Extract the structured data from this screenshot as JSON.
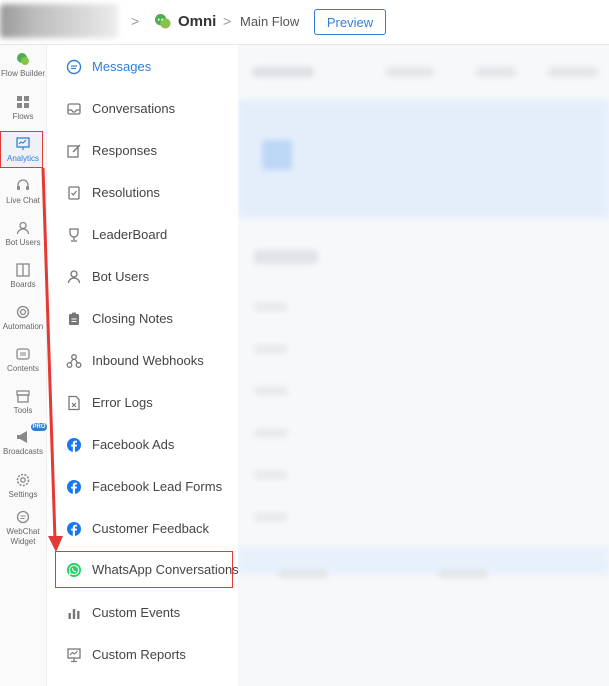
{
  "header": {
    "bot_name": "Omni",
    "flow_name": "Main Flow",
    "preview_label": "Preview",
    "separator": ">"
  },
  "rail": {
    "items": [
      {
        "label": "Flow Builder",
        "icon": "flow-builder-icon"
      },
      {
        "label": "Flows",
        "icon": "grid-icon"
      },
      {
        "label": "Analytics",
        "icon": "analytics-icon"
      },
      {
        "label": "Live Chat",
        "icon": "headset-icon"
      },
      {
        "label": "Bot Users",
        "icon": "user-icon"
      },
      {
        "label": "Boards",
        "icon": "board-icon"
      },
      {
        "label": "Automation",
        "icon": "automation-icon"
      },
      {
        "label": "Contents",
        "icon": "contents-icon"
      },
      {
        "label": "Tools",
        "icon": "tools-icon"
      },
      {
        "label": "Broadcasts",
        "icon": "megaphone-icon"
      },
      {
        "label": "Settings",
        "icon": "gear-icon"
      },
      {
        "label": "WebChat Widget",
        "icon": "chat-icon"
      }
    ],
    "pro_badge": "PRO"
  },
  "menu": {
    "items": [
      {
        "label": "Messages",
        "icon": "message-icon"
      },
      {
        "label": "Conversations",
        "icon": "inbox-icon"
      },
      {
        "label": "Responses",
        "icon": "edit-icon"
      },
      {
        "label": "Resolutions",
        "icon": "resolution-icon"
      },
      {
        "label": "LeaderBoard",
        "icon": "trophy-icon"
      },
      {
        "label": "Bot Users",
        "icon": "user-icon"
      },
      {
        "label": "Closing Notes",
        "icon": "clipboard-icon"
      },
      {
        "label": "Inbound Webhooks",
        "icon": "webhook-icon"
      },
      {
        "label": "Error Logs",
        "icon": "error-log-icon"
      },
      {
        "label": "Facebook Ads",
        "icon": "facebook-icon"
      },
      {
        "label": "Facebook Lead Forms",
        "icon": "facebook-icon"
      },
      {
        "label": "Customer Feedback",
        "icon": "facebook-icon"
      },
      {
        "label": "WhatsApp Conversations",
        "icon": "whatsapp-icon"
      },
      {
        "label": "Custom Events",
        "icon": "bar-chart-icon"
      },
      {
        "label": "Custom Reports",
        "icon": "report-icon"
      }
    ]
  },
  "colors": {
    "accent": "#2f7fd8",
    "highlight": "#e53935",
    "facebook": "#1877f2",
    "whatsapp": "#25d366"
  }
}
